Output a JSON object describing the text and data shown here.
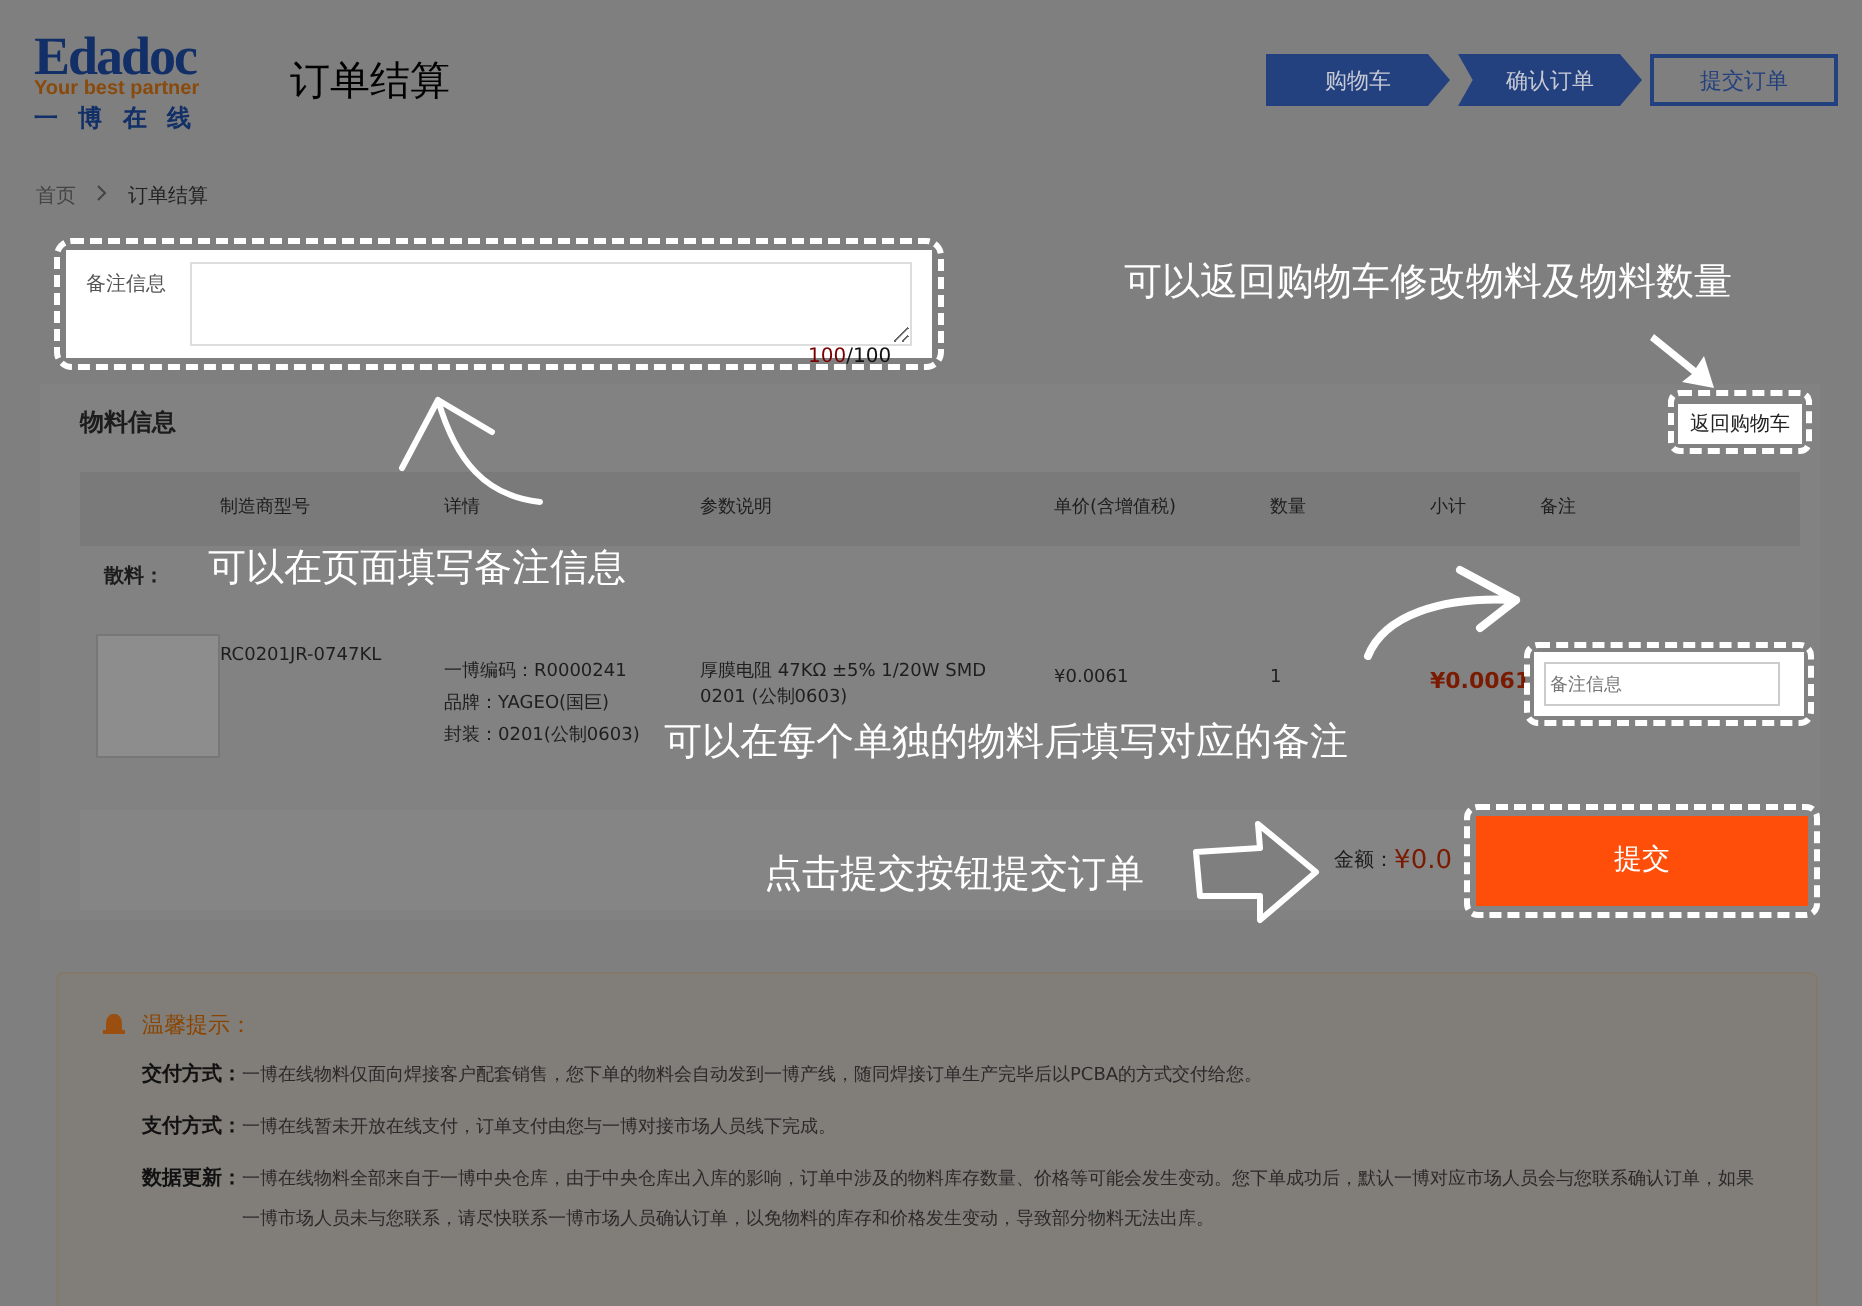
{
  "header": {
    "logo": {
      "wordmark": "Edadoc",
      "tagline": "Your best partner",
      "chinese": "一 博 在 线"
    },
    "title": "订单结算",
    "steps": [
      {
        "label": "购物车",
        "done": true
      },
      {
        "label": "确认订单",
        "done": true
      },
      {
        "label": "提交订单",
        "done": false
      }
    ]
  },
  "breadcrumb": [
    "首页",
    "订单结算"
  ],
  "remark": {
    "label": "备注信息",
    "count": "100",
    "max": "/100"
  },
  "materials": {
    "title": "物料信息",
    "back_button": "返回购物车",
    "columns": [
      "制造商型号",
      "详情",
      "参数说明",
      "单价(含增值税)",
      "数量",
      "小计",
      "备注"
    ],
    "group": "散料：",
    "rows": [
      {
        "model": "RC0201JR-0747KL",
        "details": [
          "一博编码：R0000241",
          "品牌：YAGEO(国巨)",
          "封装：0201(公制0603)"
        ],
        "params": "厚膜电阻 47KΩ ±5% 1/20W SMD 0201 (公制0603)",
        "price": "¥0.0061",
        "qty": "1",
        "subtotal": "¥0.0061",
        "remark_placeholder": "备注信息"
      }
    ],
    "total_label": "金额：",
    "total": "¥0.0",
    "submit": "提交"
  },
  "tips": {
    "title": "温馨提示：",
    "items": [
      {
        "label": "交付方式：",
        "text": "一博在线物料仅面向焊接客户配套销售，您下单的物料会自动发到一博产线，随同焊接订单生产完毕后以PCBA的方式交付给您。"
      },
      {
        "label": "支付方式：",
        "text": "一博在线暂未开放在线支付，订单支付由您与一博对接市场人员线下完成。"
      },
      {
        "label": "数据更新：",
        "text": "一博在线物料全部来自于一博中央仓库，由于中央仓库出入库的影响，订单中涉及的物料库存数量、价格等可能会发生变动。您下单成功后，默认一博对应市场人员会与您联系确认订单，如果一博市场人员未与您联系，请尽快联系一博市场人员确认订单，以免物料的库存和价格发生变动，导致部分物料无法出库。"
      }
    ]
  },
  "annotations": [
    "可以返回购物车修改物料及物料数量",
    "可以在页面填写备注信息",
    "可以在每个单独的物料后填写对应的备注",
    "点击提交按钮提交订单"
  ]
}
